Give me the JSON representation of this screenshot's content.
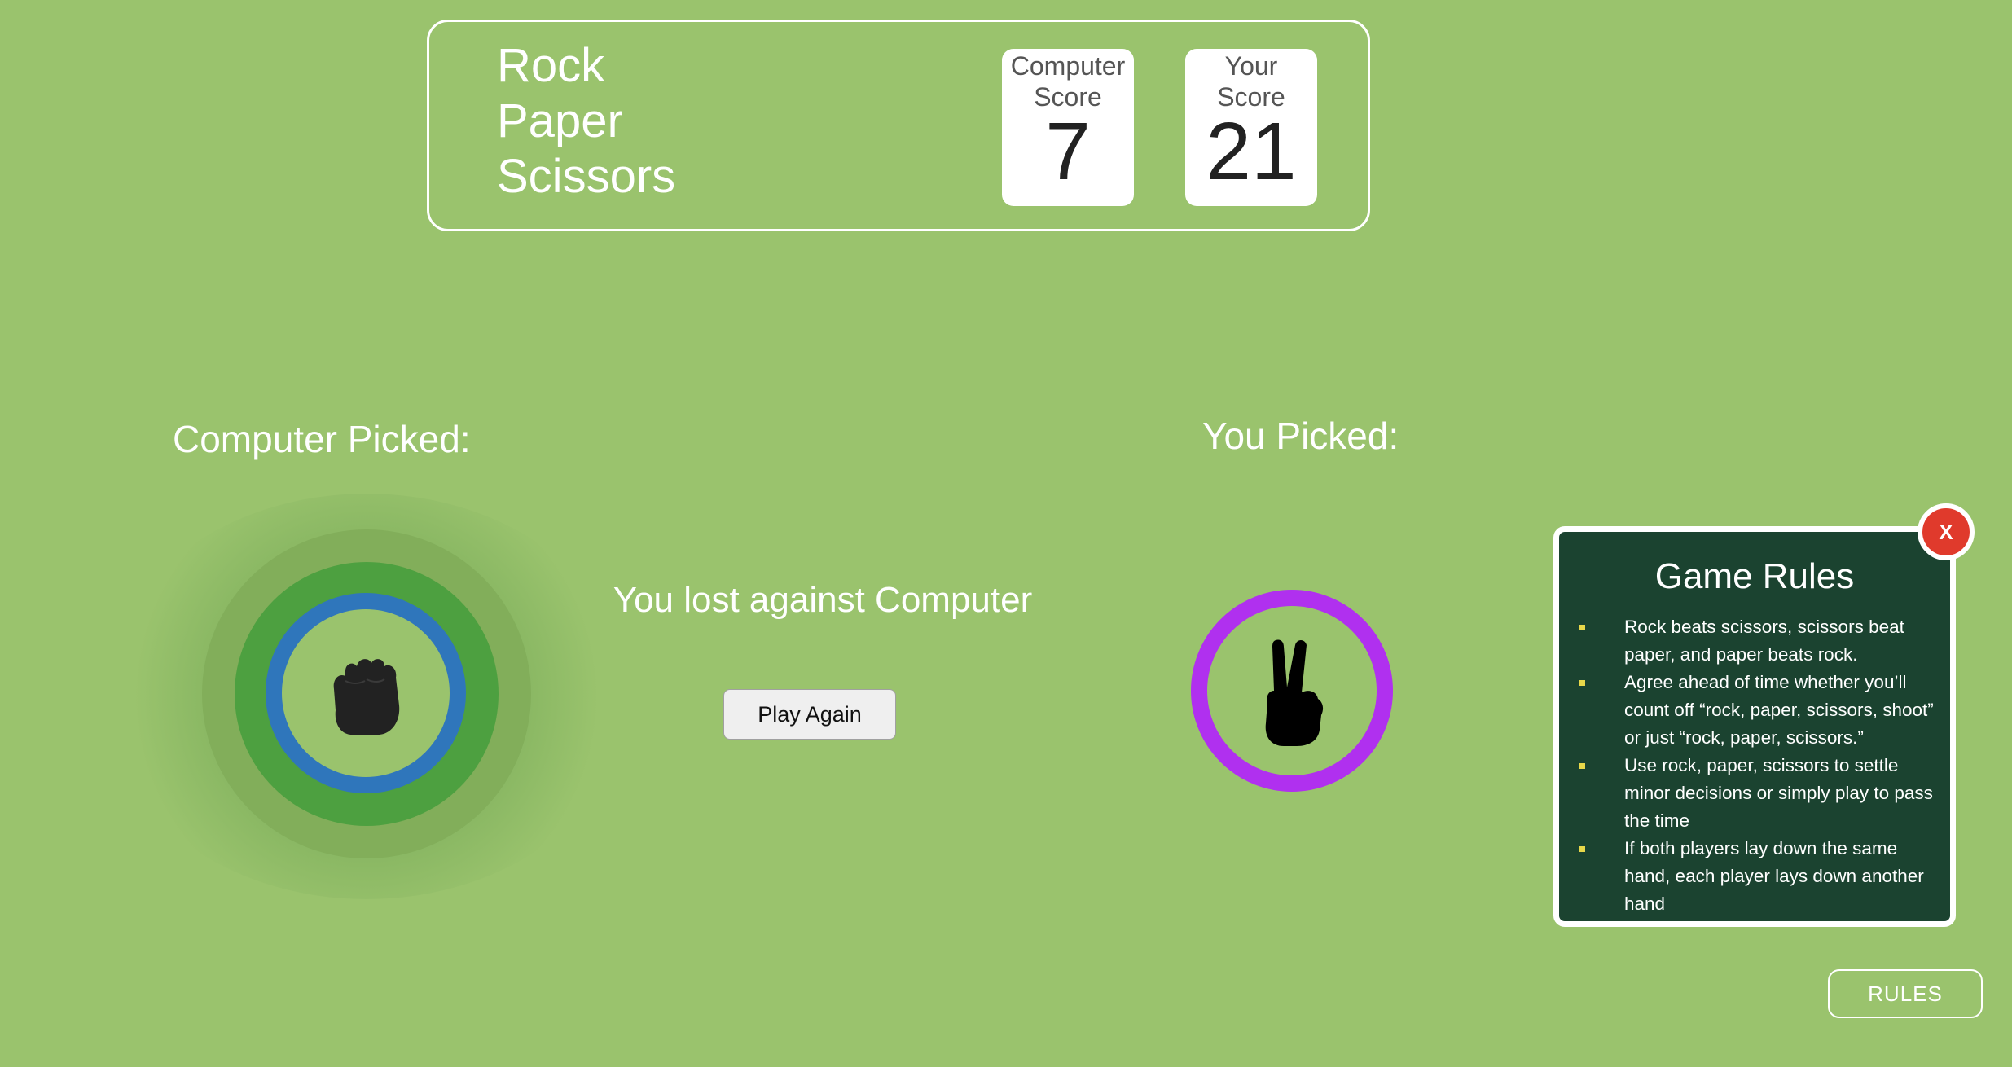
{
  "header": {
    "title_lines": [
      "Rock",
      "Paper",
      "Scissors"
    ],
    "computer_score": {
      "label_line1": "Computer",
      "label_line2": "Score",
      "value": "7"
    },
    "your_score": {
      "label_line1": "Your",
      "label_line2": "Score",
      "value": "21"
    }
  },
  "computer_pick": {
    "label": "Computer Picked:",
    "choice_icon": "rock-fist-icon",
    "ring_color": "#2f76bb"
  },
  "your_pick": {
    "label": "You Picked:",
    "choice_icon": "scissors-hand-icon",
    "ring_color": "#b030ef"
  },
  "result": {
    "message": "You lost against Computer",
    "play_again_label": "Play Again"
  },
  "rules_panel": {
    "title": "Game Rules",
    "close_label": "X",
    "rules": [
      "Rock beats scissors, scissors beat paper, and paper beats rock.",
      "Agree ahead of time whether you’ll count off “rock, paper, scissors, shoot” or just “rock, paper, scissors.”",
      "Use rock, paper, scissors to settle minor decisions or simply play to pass the time",
      "If both players lay down the same hand, each player lays down another hand"
    ]
  },
  "rules_button_label": "RULES",
  "colors": {
    "background": "#9ac36d",
    "panel": "#1b4330",
    "close": "#e03a2c",
    "bullet": "#e8d84a"
  }
}
